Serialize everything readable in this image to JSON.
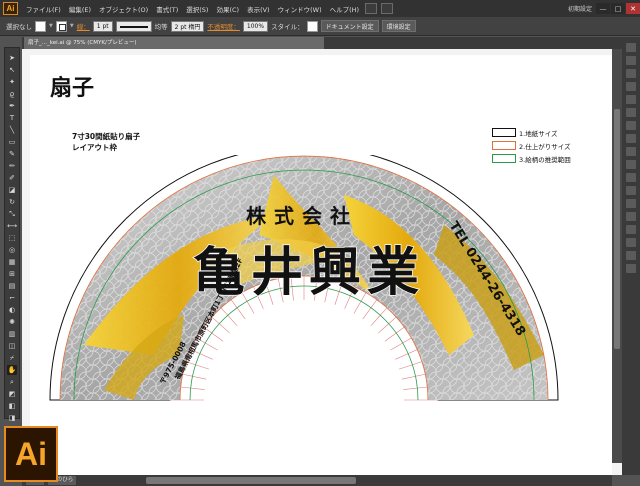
{
  "app": {
    "logo": "Ai",
    "menu": [
      "ファイル(F)",
      "編集(E)",
      "オブジェクト(O)",
      "書式(T)",
      "選択(S)",
      "効果(C)",
      "表示(V)",
      "ウィンドウ(W)",
      "ヘルプ(H)"
    ],
    "workspace": "初期設定",
    "window_buttons": [
      "—",
      "□",
      "✕"
    ]
  },
  "controlbar": {
    "selection": "選択なし",
    "stroke_label": "線：",
    "stroke_weight": "1 pt",
    "stroke_profile": "均等",
    "brush": "2 pt 楕円",
    "opacity_label": "不透明度：",
    "opacity": "100%",
    "style_label": "スタイル：",
    "doc_setup": "ドキュメント設定",
    "prefs": "環境設定"
  },
  "tab": {
    "title": "扇子_..._kei.ai @ 75% (CMYK/プレビュー)"
  },
  "artboard": {
    "title": "扇子",
    "sub1": "7寸30間紙貼り扇子",
    "sub2": "レイアウト枠",
    "legend": [
      {
        "label": "1.地紙サイズ",
        "color": "#111111"
      },
      {
        "label": "2.仕上がりサイズ",
        "color": "#e07040"
      },
      {
        "label": "3.絵柄の推奨範囲",
        "color": "#2a9a4a"
      }
    ]
  },
  "fan": {
    "top_text": "株式会社",
    "name_text": "亀井興業",
    "tel": "TEL 0244-26-4318",
    "address": "福島県南相馬市原町区本町1丁目62番地2F",
    "zip": "〒975-0008",
    "colors": {
      "gold": "#e9b417",
      "silver": "#a9a9a9",
      "black": "#111111"
    }
  },
  "statusbar": {
    "zoom": "75%",
    "tool": "手のひら"
  }
}
